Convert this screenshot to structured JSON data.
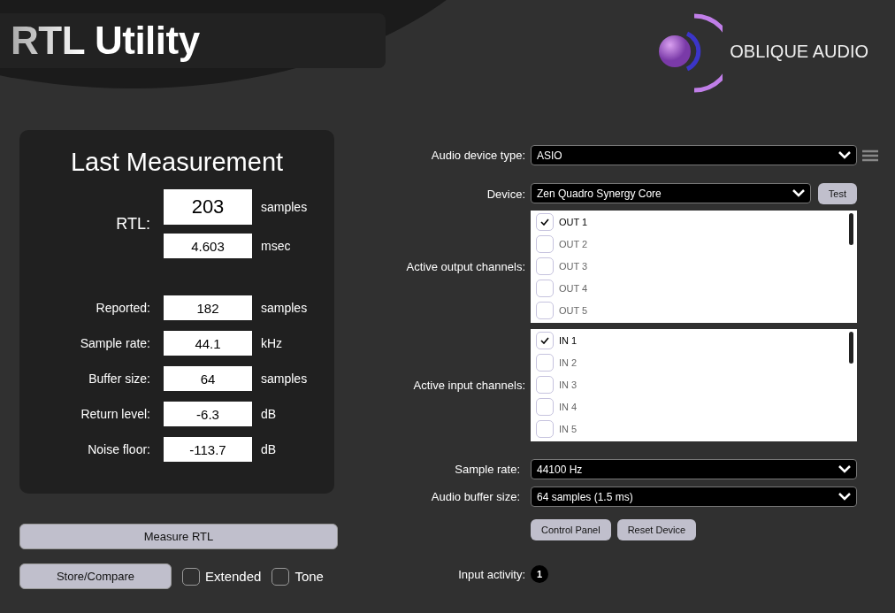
{
  "app_title": "RTL Utility",
  "brand": "OBLIQUE AUDIO",
  "measurement": {
    "title": "Last Measurement",
    "rtl_label": "RTL:",
    "rtl_values": [
      {
        "value": "203",
        "unit": "samples"
      },
      {
        "value": "4.603",
        "unit": "msec"
      }
    ],
    "rows": [
      {
        "label": "Reported:",
        "value": "182",
        "unit": "samples"
      },
      {
        "label": "Sample rate:",
        "value": "44.1",
        "unit": "kHz"
      },
      {
        "label": "Buffer size:",
        "value": "64",
        "unit": "samples"
      },
      {
        "label": "Return level:",
        "value": "-6.3",
        "unit": "dB"
      },
      {
        "label": "Noise floor:",
        "value": "-113.7",
        "unit": "dB"
      }
    ]
  },
  "measure_button": "Measure RTL",
  "store_button": "Store/Compare",
  "options": [
    {
      "label": "Extended",
      "checked": false
    },
    {
      "label": "Tone",
      "checked": false
    }
  ],
  "device_type": {
    "label": "Audio device type:",
    "value": "ASIO"
  },
  "device": {
    "label": "Device:",
    "value": "Zen Quadro Synergy Core",
    "test_button": "Test"
  },
  "output_channels": {
    "label": "Active output channels:",
    "items": [
      {
        "label": "OUT 1",
        "checked": true
      },
      {
        "label": "OUT 2",
        "checked": false
      },
      {
        "label": "OUT 3",
        "checked": false
      },
      {
        "label": "OUT 4",
        "checked": false
      },
      {
        "label": "OUT 5",
        "checked": false
      }
    ]
  },
  "input_channels": {
    "label": "Active input channels:",
    "items": [
      {
        "label": "IN 1",
        "checked": true
      },
      {
        "label": "IN 2",
        "checked": false
      },
      {
        "label": "IN 3",
        "checked": false
      },
      {
        "label": "IN 4",
        "checked": false
      },
      {
        "label": "IN 5",
        "checked": false
      }
    ]
  },
  "sample_rate": {
    "label": "Sample rate:",
    "value": "44100 Hz"
  },
  "buffer_size": {
    "label": "Audio buffer size:",
    "value": "64 samples (1.5 ms)"
  },
  "device_buttons": [
    "Control Panel",
    "Reset Device"
  ],
  "input_activity": {
    "label": "Input activity:",
    "badge": "1"
  }
}
